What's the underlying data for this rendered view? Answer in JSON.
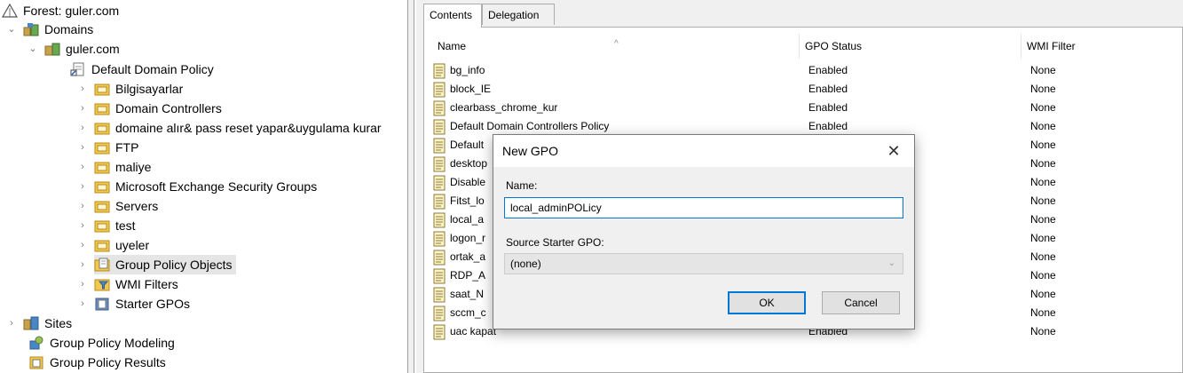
{
  "tree": {
    "forest": "Forest: guler.com",
    "domains": "Domains",
    "domain": "guler.com",
    "items": [
      {
        "label": "Default Domain Policy"
      },
      {
        "label": "Bilgisayarlar"
      },
      {
        "label": "Domain Controllers"
      },
      {
        "label": "domaine alır& pass reset yapar&uygulama kurar"
      },
      {
        "label": "FTP"
      },
      {
        "label": "maliye"
      },
      {
        "label": "Microsoft Exchange Security Groups"
      },
      {
        "label": "Servers"
      },
      {
        "label": "test"
      },
      {
        "label": "uyeler"
      },
      {
        "label": "Group Policy Objects"
      },
      {
        "label": "WMI Filters"
      },
      {
        "label": "Starter GPOs"
      }
    ],
    "sites": "Sites",
    "modeling": "Group Policy Modeling",
    "results": "Group Policy Results"
  },
  "tabs": [
    {
      "label": "Contents"
    },
    {
      "label": "Delegation"
    }
  ],
  "list": {
    "columns": {
      "name": "Name",
      "status": "GPO Status",
      "wmi": "WMI Filter"
    },
    "rows": [
      {
        "name": "bg_info",
        "status": "Enabled",
        "wmi": "None"
      },
      {
        "name": "block_IE",
        "status": "Enabled",
        "wmi": "None"
      },
      {
        "name": "clearbass_chrome_kur",
        "status": "Enabled",
        "wmi": "None"
      },
      {
        "name": "Default Domain Controllers Policy",
        "status": "Enabled",
        "wmi": "None"
      },
      {
        "name": "Default",
        "status": "",
        "wmi": "None"
      },
      {
        "name": "desktop",
        "status": "",
        "wmi": "None"
      },
      {
        "name": "Disable",
        "status": "",
        "wmi": "None"
      },
      {
        "name": "Fitst_lo",
        "status": "",
        "wmi": "None"
      },
      {
        "name": "local_a",
        "status": "",
        "wmi": "None"
      },
      {
        "name": "logon_r",
        "status": "",
        "wmi": "None"
      },
      {
        "name": "ortak_a",
        "status": "",
        "wmi": "None"
      },
      {
        "name": "RDP_A",
        "status": "",
        "wmi": "None"
      },
      {
        "name": "saat_N",
        "status": "",
        "wmi": "None"
      },
      {
        "name": "sccm_c",
        "status": "",
        "wmi": "None"
      },
      {
        "name": "uac kapat",
        "status": "Enabled",
        "wmi": "None"
      }
    ]
  },
  "dialog": {
    "title": "New GPO",
    "close": "✕",
    "name_label": "Name:",
    "name_value": "local_adminPOLicy",
    "source_label": "Source Starter GPO:",
    "source_value": "(none)",
    "ok": "OK",
    "cancel": "Cancel"
  },
  "colors": {
    "accent": "#0078d7",
    "selection": "#e5e5e5",
    "folder": "#f2c94c"
  }
}
